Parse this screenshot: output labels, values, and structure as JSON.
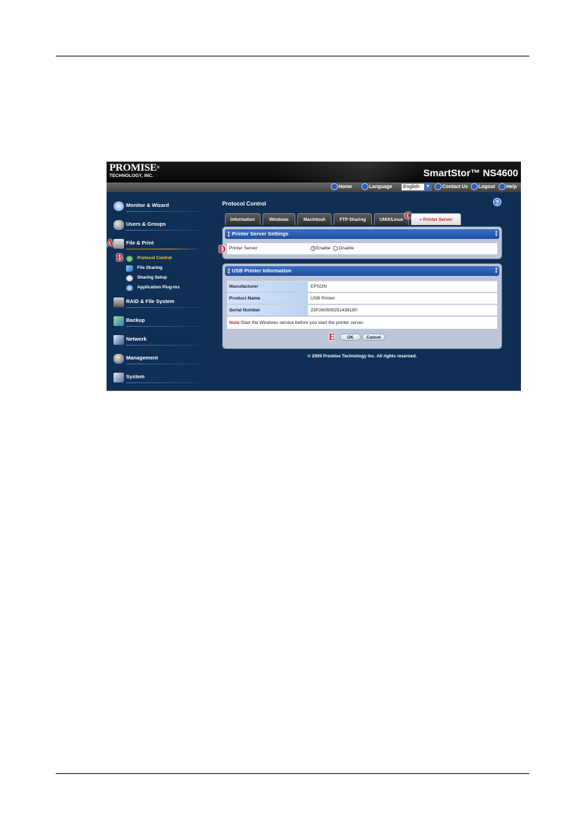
{
  "header": {
    "brand": "PROMISE",
    "brand_mark": "®",
    "brand_sub": "TECHNOLOGY, INC.",
    "product": "SmartStor™ NS4600"
  },
  "utility": {
    "home": "Home",
    "language": "Language",
    "language_value": "English",
    "contact": "Contact Us",
    "logout": "Logout",
    "help": "Help"
  },
  "nav": {
    "items": [
      {
        "label": "Monitor & Wizard"
      },
      {
        "label": "Users & Groups"
      },
      {
        "label": "File & Print"
      },
      {
        "label": "RAID & File System"
      },
      {
        "label": "Backup"
      },
      {
        "label": "Network"
      },
      {
        "label": "Management"
      },
      {
        "label": "System"
      }
    ],
    "sub_items": [
      {
        "label": "Protocol Control"
      },
      {
        "label": "File Sharing"
      },
      {
        "label": "Sharing Setup"
      },
      {
        "label": "Application Plug-ins"
      }
    ]
  },
  "callouts": {
    "a": "A",
    "b": "B",
    "c": "C",
    "d": "D",
    "e": "E"
  },
  "main": {
    "title": "Protocol Control",
    "help_glyph": "?",
    "tabs": [
      {
        "label": "Information"
      },
      {
        "label": "Windows"
      },
      {
        "label": "Macintosh"
      },
      {
        "label": "FTP Sharing"
      },
      {
        "label": "UNIX/Linux"
      },
      {
        "label": "Printer Server"
      }
    ],
    "tab_active_prefix": "»",
    "settings_panel": {
      "title": "Printer Server Settings",
      "field_label": "Printer Server",
      "enable": "Enable",
      "disable": "Disable",
      "selected": "Enable"
    },
    "info_panel": {
      "title": "USB Printer Information",
      "rows": [
        {
          "label": "Manufacturer",
          "value": "EPSON"
        },
        {
          "label": "Product Name",
          "value": "USB Printer"
        },
        {
          "label": "Serial Number",
          "value": "23P260505251438180"
        }
      ],
      "note_label": "Note:",
      "note_text": "Start the Windows service before you start the printer server."
    },
    "buttons": {
      "ok": "OK",
      "cancel": "Cancel"
    },
    "copyright": "© 2009 Promise Technology Inc. All rights reserved."
  },
  "colors": {
    "background": "#0f2f55",
    "header": "#0a0a0a",
    "panel_head": "#2a5fb5",
    "active_tab_text": "#d01c1c",
    "active_sub_item": "#ffd23a",
    "callout": "#c81e1e"
  }
}
